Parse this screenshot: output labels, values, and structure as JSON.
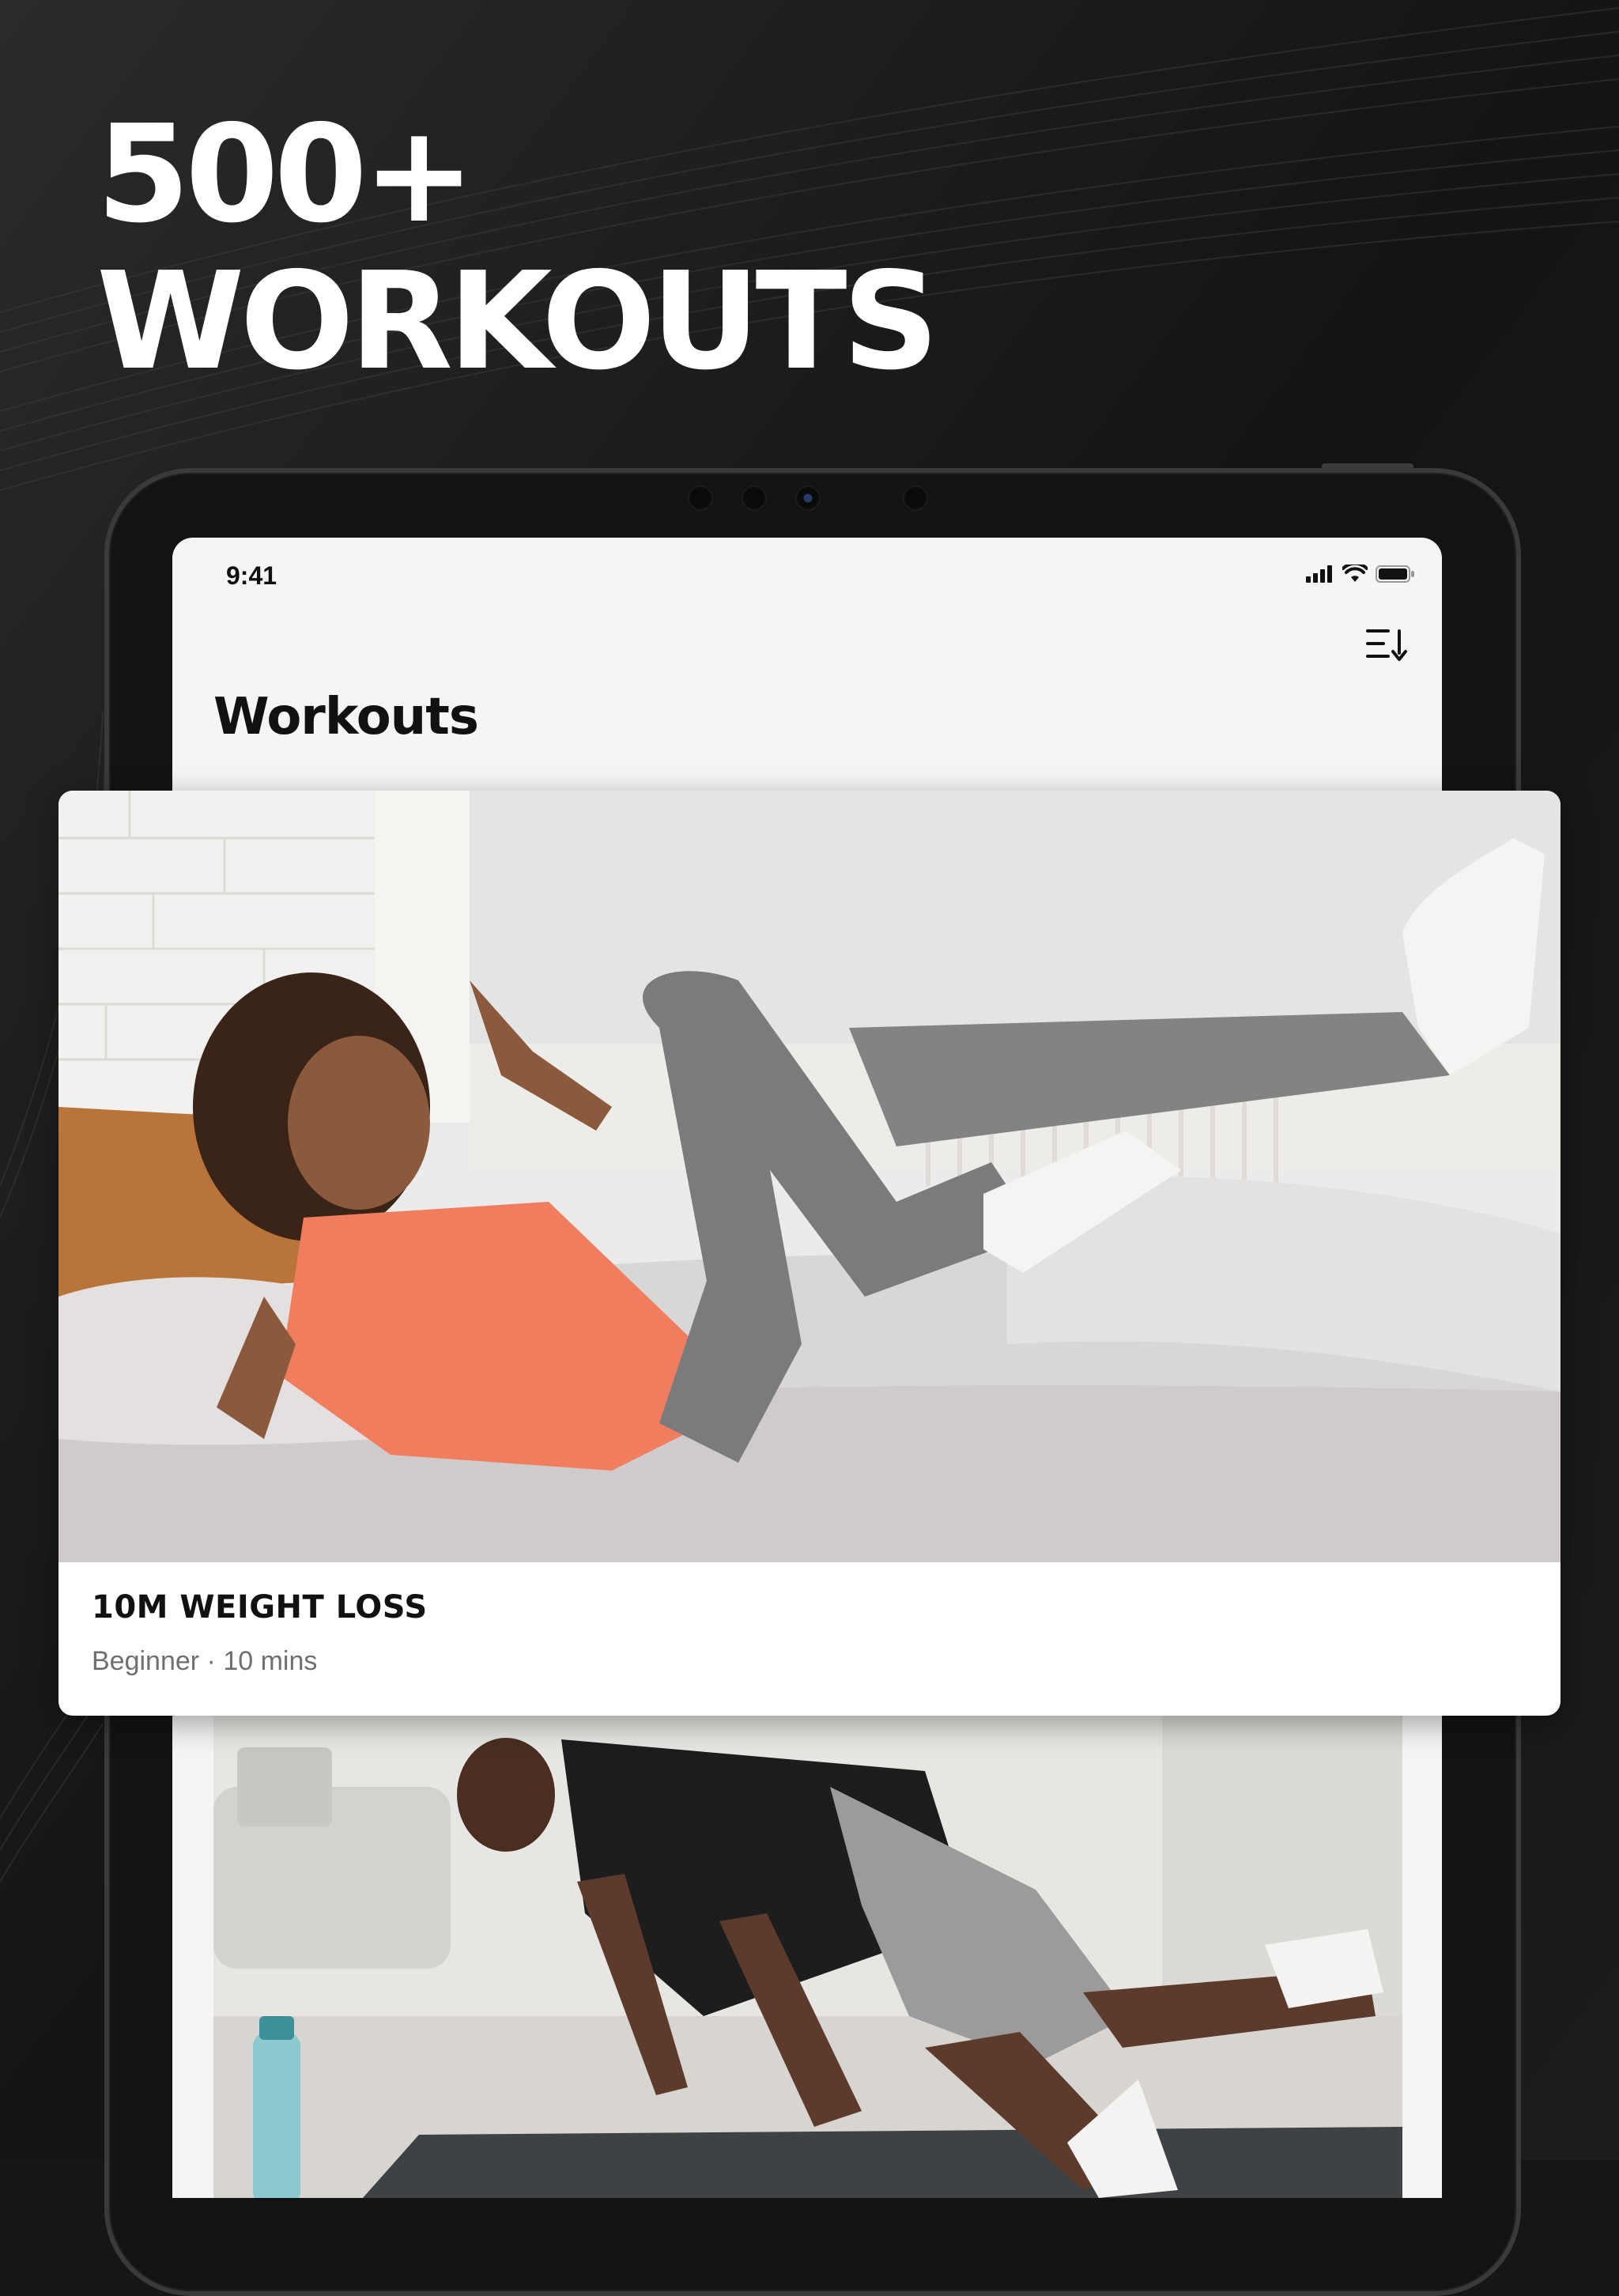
{
  "hero": {
    "line1": "500+",
    "line2": "WORKOUTS"
  },
  "status_bar": {
    "time": "9:41",
    "icons": [
      "cellular-signal-icon",
      "wifi-icon",
      "battery-icon"
    ]
  },
  "header": {
    "title": "Workouts",
    "sort_icon": "sort-icon"
  },
  "featured_workout": {
    "title": "10M WEIGHT LOSS",
    "level": "Beginner",
    "separator": "·",
    "duration": "10 mins",
    "meta": "Beginner · 10 mins"
  },
  "colors": {
    "background": "#161616",
    "screen": "#f5f5f5",
    "card": "#ffffff",
    "text_primary": "#111111",
    "text_secondary": "#6f6f6f",
    "accent_shirt": "#f07e5e"
  }
}
